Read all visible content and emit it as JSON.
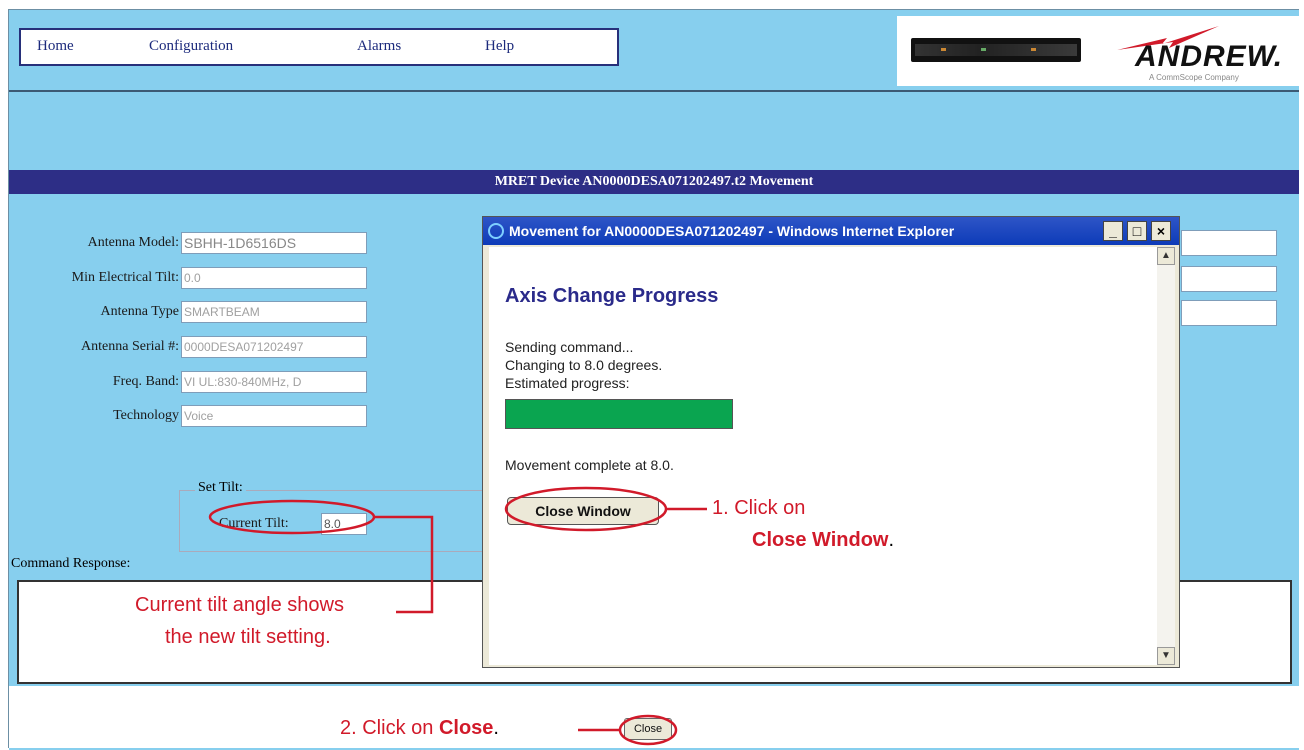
{
  "menu": {
    "home": "Home",
    "configuration": "Configuration",
    "alarms": "Alarms",
    "help": "Help"
  },
  "brand": {
    "name": "ANDREW.",
    "tagline": "A CommScope Company",
    "device_image": "rack-device-image",
    "accent_color": "#d11a2a"
  },
  "page_title": "MRET Device AN0000DESA071202497.t2 Movement",
  "fields": [
    {
      "label": "Antenna Model:",
      "value": "SBHH-1D6516DS"
    },
    {
      "label": "Min Electrical Tilt:",
      "value": "0.0"
    },
    {
      "label": "Antenna Type",
      "value": "SMARTBEAM"
    },
    {
      "label": "Antenna Serial #:",
      "value": "0000DESA071202497"
    },
    {
      "label": "Freq. Band:",
      "value": "VI UL:830-840MHz, D"
    },
    {
      "label": "Technology",
      "value": "Voice"
    }
  ],
  "set_tilt": {
    "legend": "Set Tilt:",
    "current_tilt_label": "Current Tilt:",
    "current_tilt_value": "8.0"
  },
  "command_response_label": "Command Response:",
  "popup": {
    "window_title": "Movement for AN0000DESA071202497 - Windows Internet Explorer",
    "heading": "Axis Change Progress",
    "line1": "Sending command...",
    "line2": "Changing to 8.0 degrees.",
    "line3": "Estimated progress:",
    "progress_percent": 100,
    "progress_color": "#0aa550",
    "complete_text": "Movement complete at 8.0.",
    "close_window_label": "Close Window"
  },
  "close_button_label": "Close",
  "annotations": {
    "step1_prefix": "1.  Click on",
    "step1_bold": "Close Window",
    "step1_suffix": ".",
    "tilt_line1": "Current tilt angle shows",
    "tilt_line2": "the new tilt setting.",
    "step2_prefix": "2.  Click on",
    "step2_bold": "Close",
    "step2_suffix": "."
  }
}
